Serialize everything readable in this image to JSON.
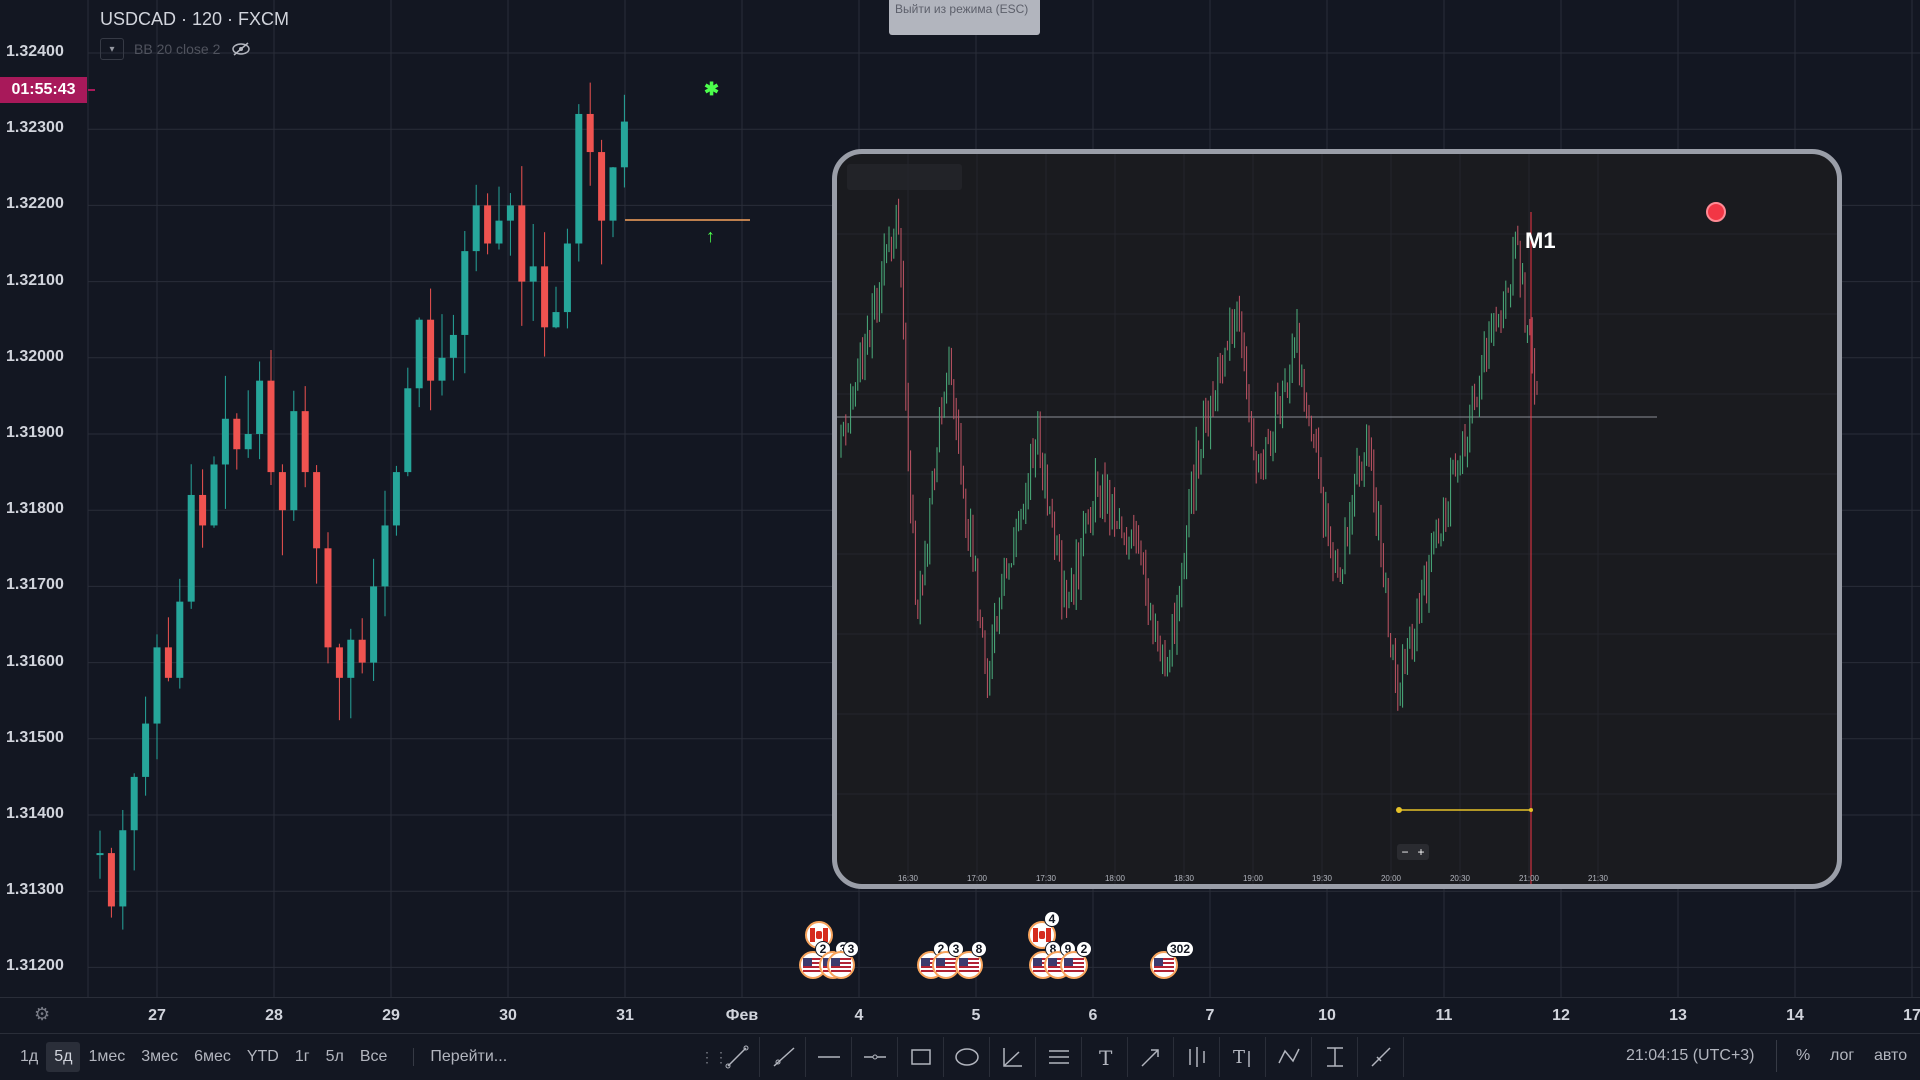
{
  "header": {
    "symbol": "USDCAD · 120 · FXCM",
    "indicator_label": "BB 20 close 2"
  },
  "fullscreen": {
    "exit_label": "Выйти из режима (ESC)"
  },
  "price_axis": {
    "labels": [
      "1.32400",
      "1.32300",
      "1.32200",
      "1.32100",
      "1.32000",
      "1.31900",
      "1.31800",
      "1.31700",
      "1.31600",
      "1.31500",
      "1.31400",
      "1.31300",
      "1.31200"
    ],
    "countdown": "01:55:43",
    "countdown_color": "#a8195a"
  },
  "time_axis": {
    "labels": [
      "27",
      "28",
      "29",
      "30",
      "31",
      "Фев",
      "4",
      "5",
      "6",
      "7",
      "10",
      "11",
      "12",
      "13",
      "14",
      "17"
    ]
  },
  "events": [
    {
      "icon": "ca-flag",
      "count": ""
    },
    {
      "icon": "us-flag",
      "count": "2"
    },
    {
      "icon": "us-flag",
      "count": "3"
    },
    {
      "icon": "us-flag",
      "count": "3"
    },
    {
      "icon": "us-flag",
      "count": "2"
    },
    {
      "icon": "us-flag",
      "count": "3"
    },
    {
      "icon": "us-flag",
      "count": "8"
    },
    {
      "icon": "ca-flag",
      "count": "4"
    },
    {
      "icon": "us-flag",
      "count": "8"
    },
    {
      "icon": "us-flag",
      "count": "9"
    },
    {
      "icon": "us-flag",
      "count": "2"
    },
    {
      "icon": "us-flag",
      "count": "302"
    }
  ],
  "overlay": {
    "title": "M1",
    "time_labels": [
      "16:30",
      "17:00",
      "17:30",
      "18:00",
      "18:30",
      "19:00",
      "19:30",
      "20:00",
      "20:30",
      "21:00",
      "21:30"
    ],
    "zoom_out": "−",
    "zoom_in": "+"
  },
  "bottom_bar": {
    "ranges": [
      "1д",
      "5д",
      "1мес",
      "3мес",
      "6мес",
      "YTD",
      "1г",
      "5л",
      "Все"
    ],
    "active_range": "5д",
    "goto": "Перейти...",
    "tools": [
      "trend-line-icon",
      "ray-icon",
      "horizontal-line-icon",
      "horizontal-ray-icon",
      "rectangle-icon",
      "ellipse-icon",
      "angle-icon",
      "parallel-channel-icon",
      "text-icon",
      "arrow-icon",
      "bars-pattern-icon",
      "text-anchor-icon",
      "path-icon",
      "price-range-icon",
      "ruler-icon"
    ],
    "clock": "21:04:15 (UTC+3)",
    "percent": "%",
    "log": "лог",
    "auto": "авто"
  },
  "colors": {
    "background": "#131722",
    "bull": "#26a69a",
    "bear": "#ef5350",
    "grid": "#2a2e39",
    "overlay_bg": "#1a1b1f",
    "level_line": "#f7a35c"
  }
}
